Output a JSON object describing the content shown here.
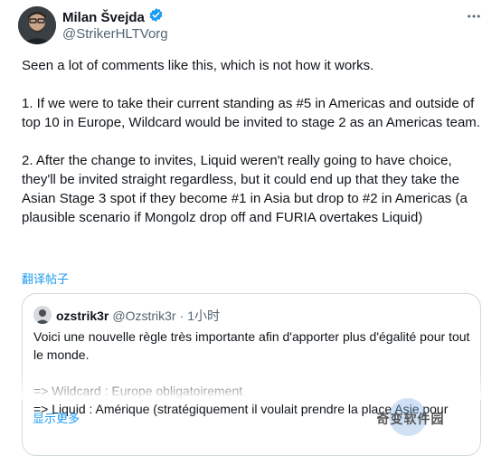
{
  "author": {
    "name": "Milan Švejda",
    "handle": "@StrikerHLTVorg",
    "verified_color": "#1d9bf0"
  },
  "tweet": {
    "text": "Seen a lot of comments like this, which is not how it works.\n\n1. If we were to take their current standing as #5 in Americas and outside of top 10 in Europe, Wildcard would be invited to stage 2 as an Americas team.\n\n2. After the change to invites, Liquid weren't really going to have choice, they'll be invited straight regardless, but it could end up that they take the Asian Stage 3 spot if they become #1 in Asia but drop to #2 in Americas (a plausible scenario if Mongolz drop off and FURIA overtakes Liquid)",
    "translate_label": "翻译帖子"
  },
  "quote": {
    "name": "ozstrik3r",
    "handle": "@Ozstrik3r",
    "separator": "·",
    "time": "1小时",
    "text": "Voici une nouvelle règle très importante afin d'apporter plus d'égalité pour tout le monde.\n\n=> Wildcard : Europe obligatoirement\n=> Liquid : Amérique (stratégiquement il voulait prendre la place Asie pour",
    "show_more_label": "显示更多"
  },
  "watermark": {
    "text": "奇变软件园"
  },
  "icons": {
    "more": "more-options-icon",
    "verified": "verified-badge-icon"
  }
}
